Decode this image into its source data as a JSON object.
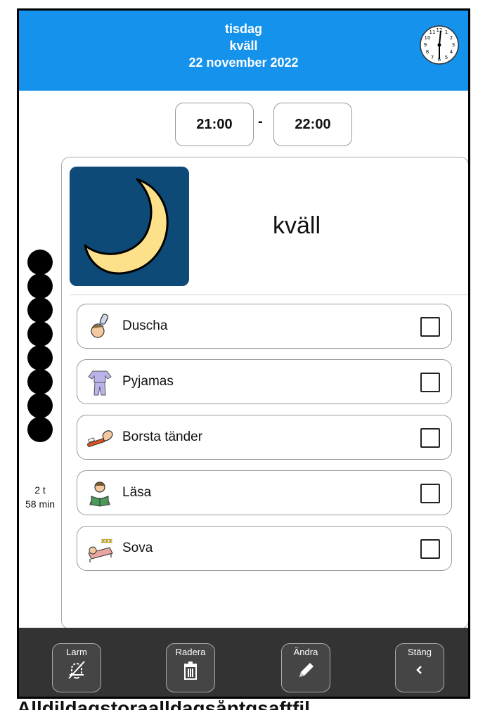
{
  "header": {
    "day": "tisdag",
    "period": "kväll",
    "date": "22 november 2022"
  },
  "time": {
    "start": "21:00",
    "separator": "-",
    "end": "22:00"
  },
  "activity": {
    "title": "kväll",
    "image_icon": "moon-icon",
    "steps": [
      {
        "label": "Duscha",
        "icon": "shower-icon",
        "checked": false
      },
      {
        "label": "Pyjamas",
        "icon": "pajamas-icon",
        "checked": false
      },
      {
        "label": "Borsta tänder",
        "icon": "toothbrush-icon",
        "checked": false
      },
      {
        "label": "Läsa",
        "icon": "reading-icon",
        "checked": false
      },
      {
        "label": "Sova",
        "icon": "sleeping-icon",
        "checked": false
      }
    ]
  },
  "timer": {
    "dots_remaining": 8,
    "hours": "2 t",
    "minutes": "58 min"
  },
  "toolbar": {
    "alarm_label": "Larm",
    "delete_label": "Radera",
    "edit_label": "Ändra",
    "close_label": "Stäng"
  },
  "footer": {
    "text": "Alldildagstoraalldagsåntgsaftfil"
  },
  "colors": {
    "header_bg": "#1592ec",
    "toolbar_bg": "#333333",
    "image_bg": "#0e4a77",
    "moon": "#fde08a"
  }
}
